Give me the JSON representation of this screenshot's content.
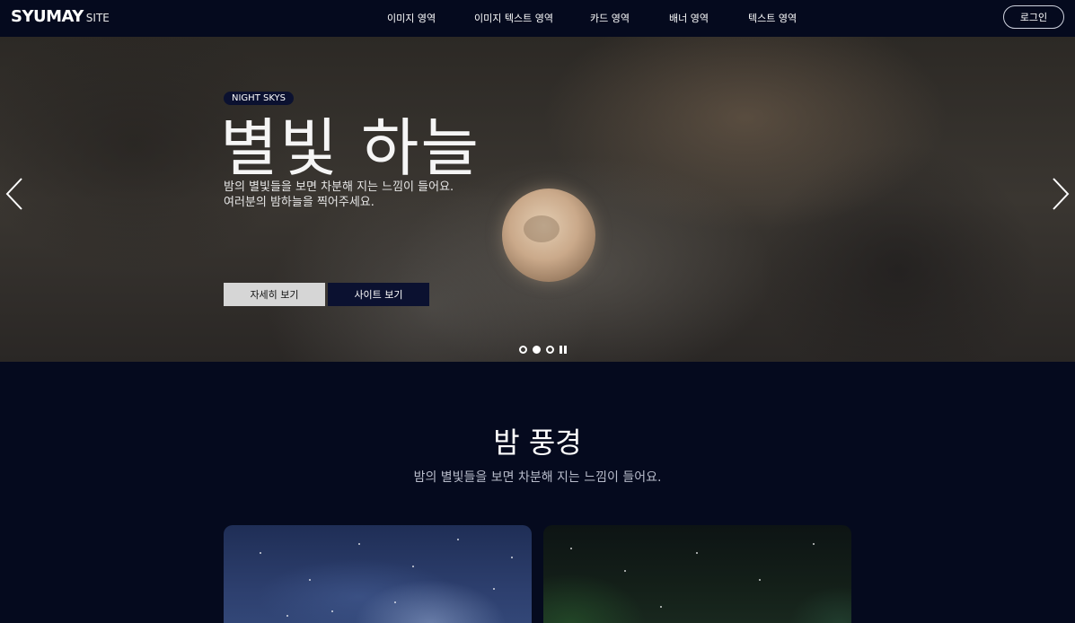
{
  "header": {
    "logo_main": "SYUMAY",
    "logo_sub": "SITE",
    "nav": [
      {
        "label": "이미지 영역"
      },
      {
        "label": "이미지 텍스트 영역"
      },
      {
        "label": "카드 영역"
      },
      {
        "label": "배너 영역"
      },
      {
        "label": "텍스트 영역"
      }
    ],
    "login_label": "로그인"
  },
  "hero": {
    "tag": "NIGHT SKYS",
    "title": "별빛 하늘",
    "desc_line1": "밤의 별빛들을 보면 차분해 지는 느낌이 들어요.",
    "desc_line2": "여러분의 밤하늘을 찍어주세요.",
    "btn_detail": "자세히 보기",
    "btn_site": "사이트 보기",
    "slides": 3,
    "active_slide": 2
  },
  "section": {
    "title": "밤 풍경",
    "desc": "밤의 별빛들을 보면 차분해 지는 느낌이 들어요."
  }
}
